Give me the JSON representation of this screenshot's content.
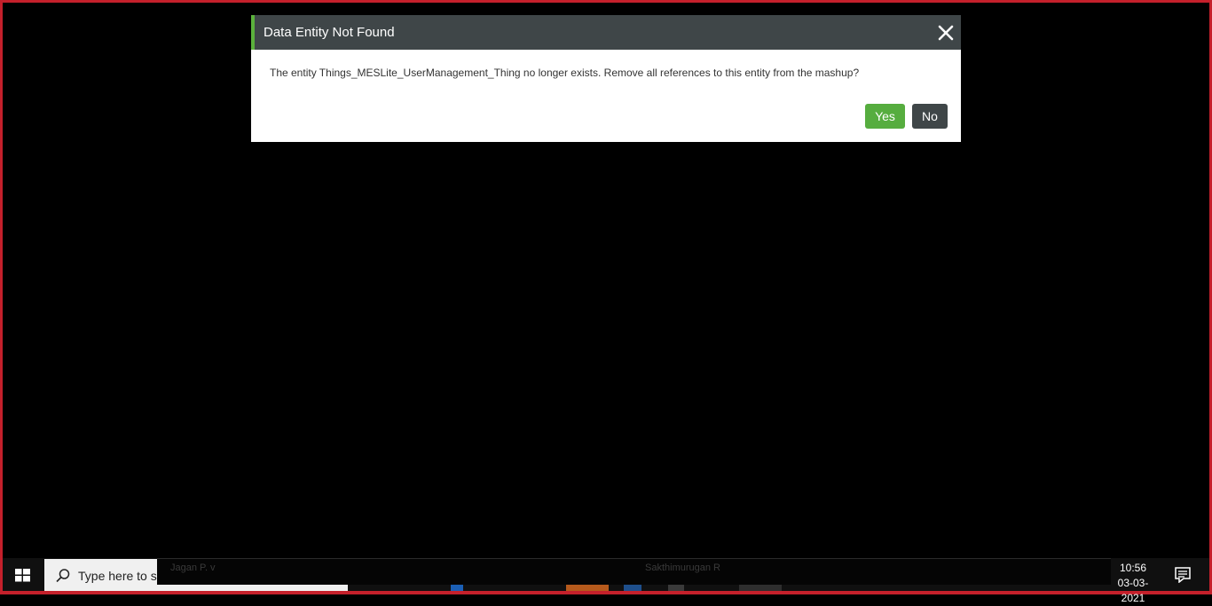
{
  "dialog": {
    "title": "Data Entity Not Found",
    "message": "The entity Things_MESLite_UserManagement_Thing no longer exists. Remove all references to this entity from the mashup?",
    "yes_label": "Yes",
    "no_label": "No",
    "close_icon": "close-icon"
  },
  "taskbar": {
    "search_text": "Type here to s",
    "overlay_names": [
      "Jagan P. v",
      "Sakthimurugan R"
    ],
    "clock_time": "10:56",
    "clock_date": "03-03-2021",
    "icons": [
      "windows-icon",
      "search-icon",
      "notification-icon"
    ]
  },
  "colors": {
    "frame_border": "#c4202b",
    "header_bg": "#3f4648",
    "header_accent": "#5bb13c",
    "yes_button": "#56ad3f",
    "no_button": "#3f4648"
  }
}
